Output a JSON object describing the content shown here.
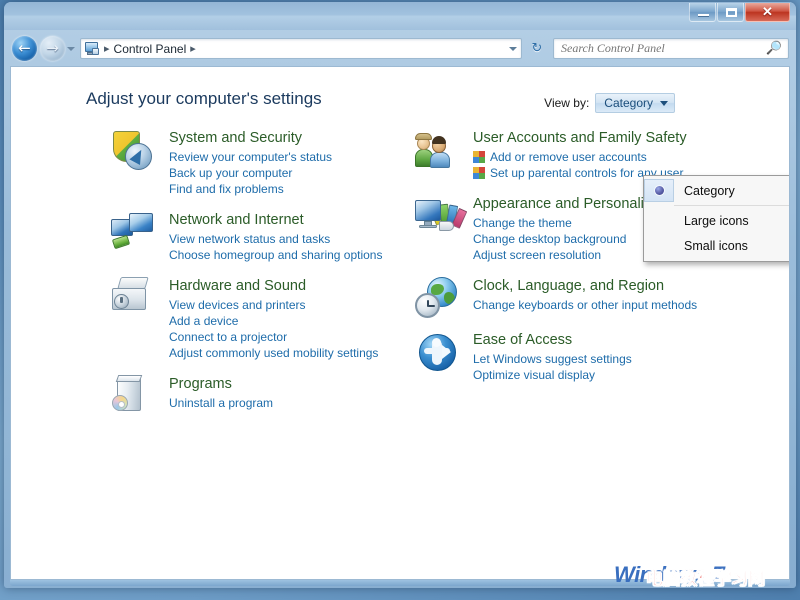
{
  "window": {
    "titlebar": {
      "minimize_label": "Minimize",
      "maximize_label": "Maximize",
      "close_label": "✕"
    }
  },
  "navigation": {
    "back_glyph": "←",
    "forward_glyph": "→",
    "refresh_glyph": "↻",
    "breadcrumb_icon": "control-panel-icon",
    "breadcrumb_sep_leading": "▸",
    "breadcrumb_sep_trailing": "▸",
    "breadcrumb": "Control Panel"
  },
  "search": {
    "placeholder": "Search Control Panel",
    "value": "",
    "icon": "🔍"
  },
  "main": {
    "page_title": "Adjust your computer's settings",
    "viewby": {
      "label": "View by:",
      "selected": "Category",
      "options": [
        "Category",
        "Large icons",
        "Small icons"
      ],
      "menu_open": true
    }
  },
  "categories": {
    "left": [
      {
        "icon": "system-and-security-icon",
        "title": "System and Security",
        "links": [
          {
            "text": "Review your computer's status",
            "shield": false
          },
          {
            "text": "Back up your computer",
            "shield": false
          },
          {
            "text": "Find and fix problems",
            "shield": false
          }
        ]
      },
      {
        "icon": "network-and-internet-icon",
        "title": "Network and Internet",
        "links": [
          {
            "text": "View network status and tasks",
            "shield": false
          },
          {
            "text": "Choose homegroup and sharing options",
            "shield": false
          }
        ]
      },
      {
        "icon": "hardware-and-sound-icon",
        "title": "Hardware and Sound",
        "links": [
          {
            "text": "View devices and printers",
            "shield": false
          },
          {
            "text": "Add a device",
            "shield": false
          },
          {
            "text": "Connect to a projector",
            "shield": false
          },
          {
            "text": "Adjust commonly used mobility settings",
            "shield": false
          }
        ]
      },
      {
        "icon": "programs-icon",
        "title": "Programs",
        "links": [
          {
            "text": "Uninstall a program",
            "shield": false
          }
        ]
      }
    ],
    "right": [
      {
        "icon": "user-accounts-icon",
        "title": "User Accounts and Family Safety",
        "links": [
          {
            "text": "Add or remove user accounts",
            "shield": true
          },
          {
            "text": "Set up parental controls for any user",
            "shield": true
          }
        ]
      },
      {
        "icon": "appearance-and-personalization-icon",
        "title": "Appearance and Personalization",
        "links": [
          {
            "text": "Change the theme",
            "shield": false
          },
          {
            "text": "Change desktop background",
            "shield": false
          },
          {
            "text": "Adjust screen resolution",
            "shield": false
          }
        ]
      },
      {
        "icon": "clock-language-region-icon",
        "title": "Clock, Language, and Region",
        "links": [
          {
            "text": "Change keyboards or other input methods",
            "shield": false
          }
        ]
      },
      {
        "icon": "ease-of-access-icon",
        "title": "Ease of Access",
        "links": [
          {
            "text": "Let Windows suggest settings",
            "shield": false
          },
          {
            "text": "Optimize visual display",
            "shield": false
          }
        ]
      }
    ]
  },
  "watermark": {
    "base_text": "Windows 7",
    "overlay_text": "电脑教程学习网"
  },
  "colors": {
    "category_title": "#2b5c28",
    "link": "#1e6caa",
    "page_title": "#1b3a5e",
    "accent": "#1c4f7c",
    "close_button": "#bc3420",
    "watermark_blue": "#3a6fbf",
    "watermark_red": "#e01c16"
  }
}
